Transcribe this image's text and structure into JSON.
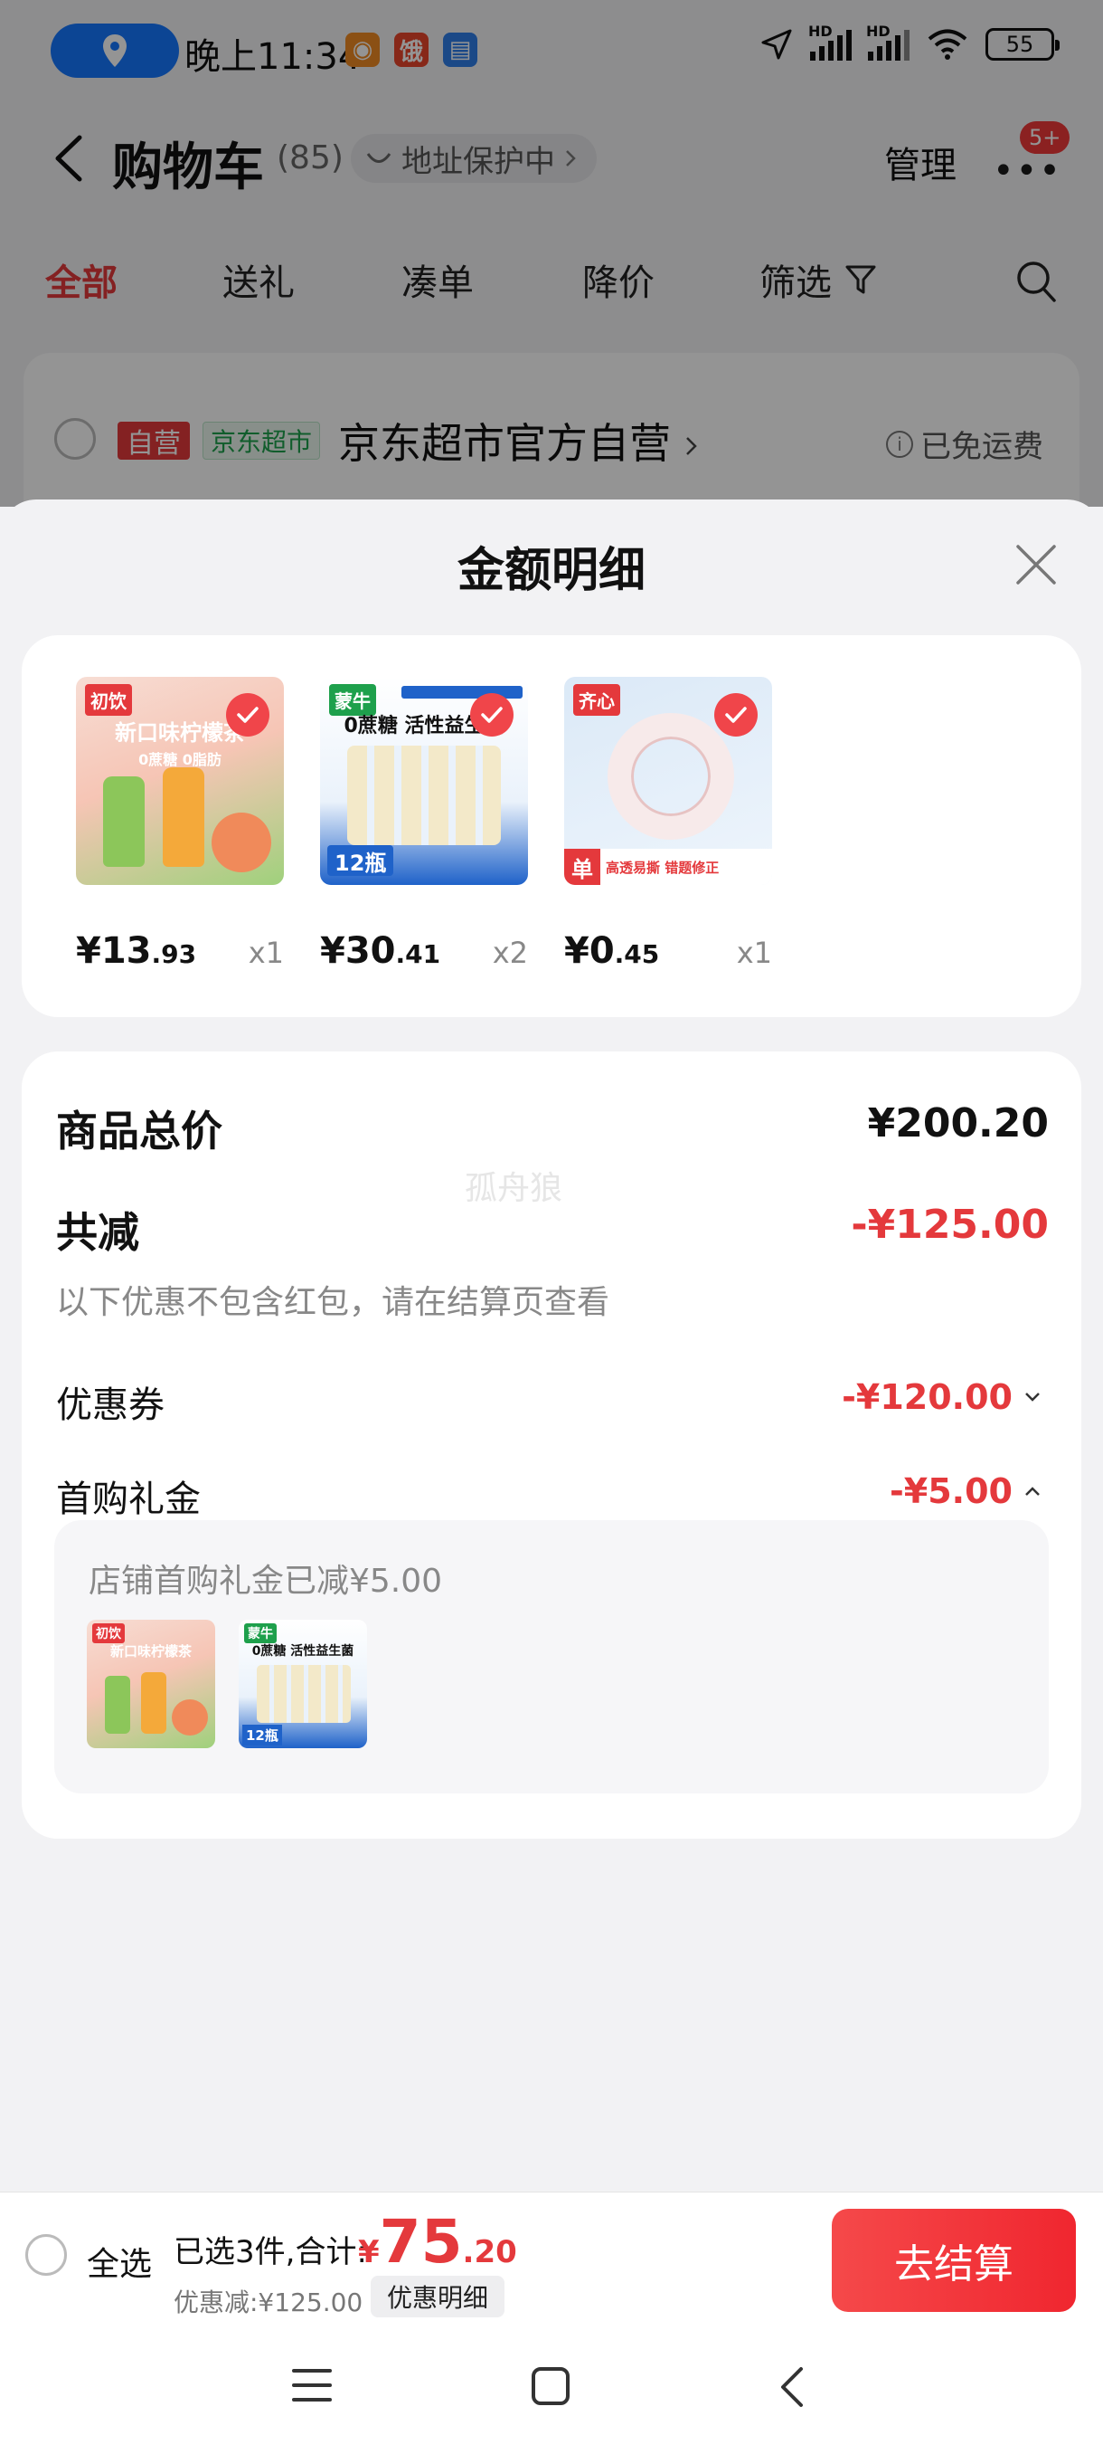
{
  "status_bar": {
    "time": "晚上11:34",
    "notif_icons": [
      {
        "name": "app-notif-icon",
        "color": "#f08a24",
        "glyph": "◉"
      },
      {
        "name": "app-notif-icon",
        "color": "#e8452c",
        "glyph": "饿"
      },
      {
        "name": "mail-notif-icon",
        "color": "#2f7ee8",
        "glyph": "▤"
      }
    ],
    "hd_label": "HD",
    "battery": "55"
  },
  "nav": {
    "title": "购物车",
    "count": "(85)",
    "address_protect": "地址保护中",
    "manage": "管理",
    "badge": "5+"
  },
  "tabs": [
    {
      "label": "全部",
      "active": true
    },
    {
      "label": "送礼",
      "active": false
    },
    {
      "label": "凑单",
      "active": false
    },
    {
      "label": "降价",
      "active": false
    },
    {
      "label": "筛选",
      "active": false
    }
  ],
  "store": {
    "tag_self": "自营",
    "tag_super": "京东超市",
    "name": "京东超市官方自营",
    "shipping": "已免运费"
  },
  "sheet": {
    "title": "金额明细",
    "products": [
      {
        "brand": "初饮",
        "thumb_title": "新口味柠檬茶",
        "thumb_sub": "0蔗糖 0脂肪",
        "price_int": "¥13",
        "price_dec": ".93",
        "qty": "x1"
      },
      {
        "brand": "蒙牛",
        "thumb_title": "0蔗糖 活性益生菌",
        "thumb_sub": "12瓶",
        "price_int": "¥30",
        "price_dec": ".41",
        "qty": "x2"
      },
      {
        "brand": "齐心",
        "thumb_title": "单",
        "thumb_sub": "高透易撕 错题修正",
        "price_int": "¥0",
        "price_dec": ".45",
        "qty": "x1"
      }
    ],
    "summary": {
      "total_label": "商品总价",
      "total_value": "¥200.20",
      "reduce_label": "共减",
      "reduce_value": "-¥125.00",
      "hint": "以下优惠不包含红包，请在结算页查看",
      "coupon_label": "优惠券",
      "coupon_value": "-¥120.00",
      "gift_label": "首购礼金",
      "gift_value": "-¥5.00",
      "gift_panel_text": "店铺首购礼金已减¥5.00",
      "watermark": "孤舟狼"
    }
  },
  "bottom_bar": {
    "select_all": "全选",
    "selected_text": "已选3件,合计:",
    "total_cur": "¥",
    "total_int": "75",
    "total_dec": ".20",
    "discount_text": "优惠减:¥125.00",
    "detail_chip": "优惠明细",
    "checkout": "去结算"
  },
  "colors": {
    "accent_red": "#e4393c",
    "location_blue": "#1677ff"
  }
}
